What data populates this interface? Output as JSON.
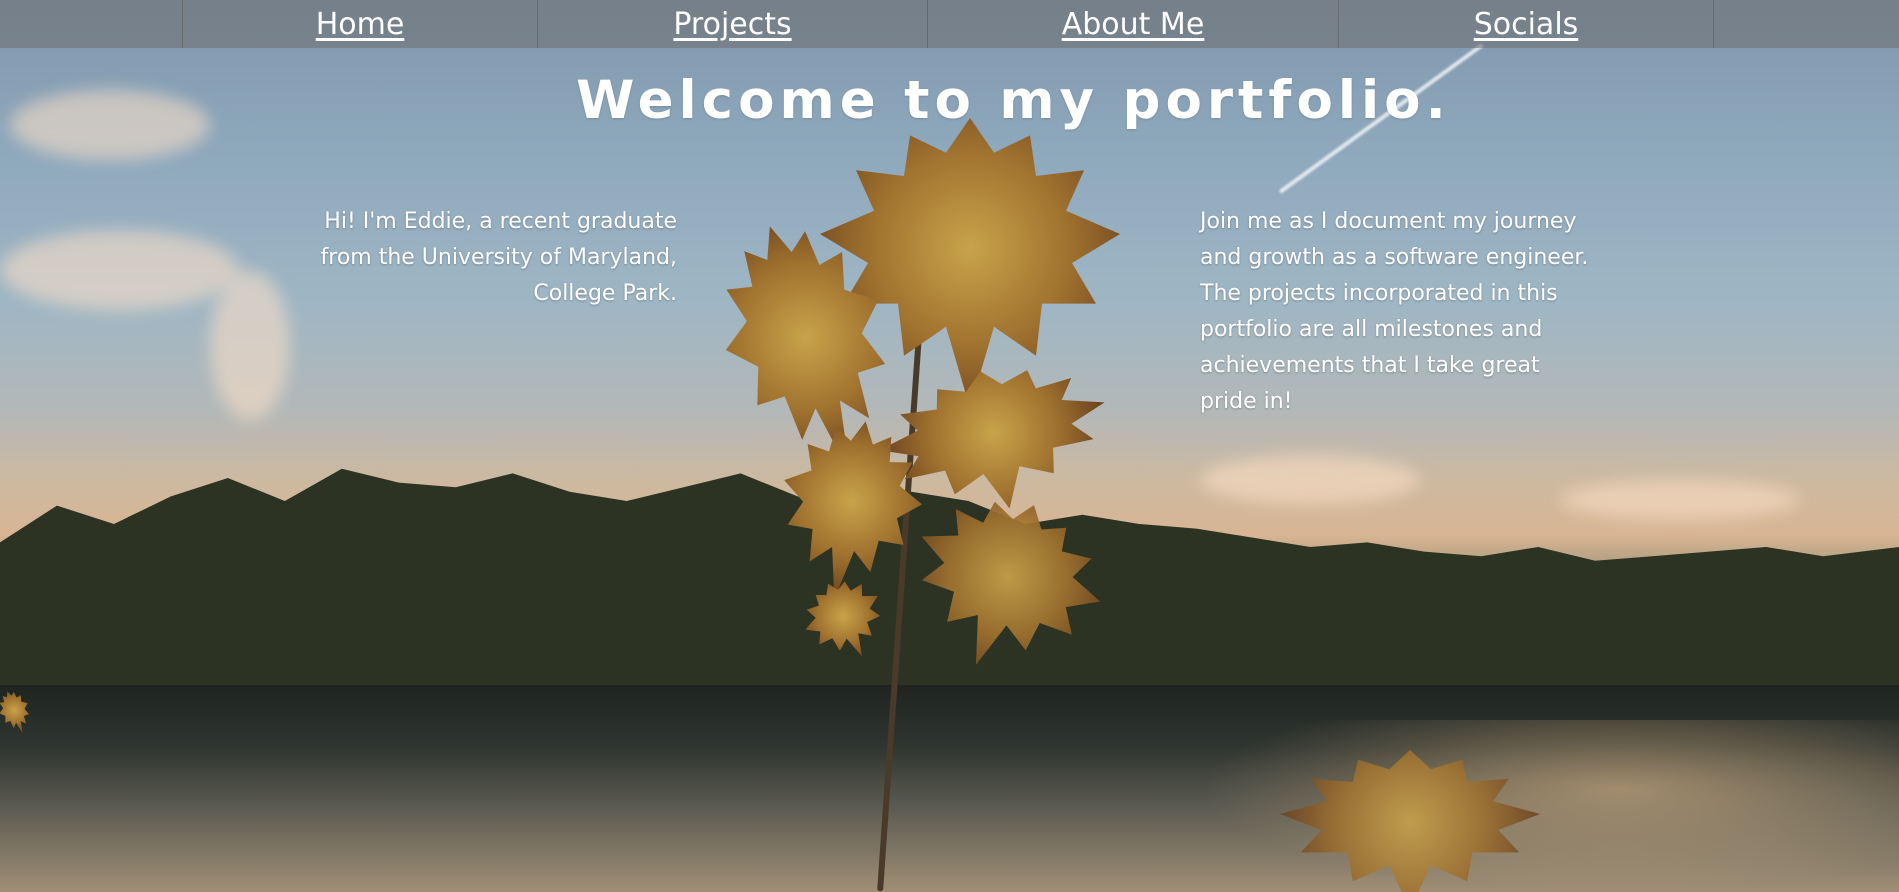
{
  "nav": {
    "home_label": "Home",
    "projects_label": "Projects",
    "about_label": "About Me",
    "socials_label": "Socials"
  },
  "hero": {
    "title": "Welcome to my portfolio.",
    "intro": "Hi! I'm Eddie, a recent graduate\nfrom the University of Maryland,\nCollege Park.",
    "journey": "Join me as I document my journey\nand growth as a software engineer.\nThe projects incorporated in this\nportfolio are all milestones and\nachievements that I take great\npride in!"
  },
  "background": {
    "scene": "autumn leaves over lake at sunset",
    "colors": {
      "sky": "#8fa9bd",
      "sunset": "#d8b593",
      "trees": "#2d3322",
      "leaf": "#a0722f"
    }
  }
}
